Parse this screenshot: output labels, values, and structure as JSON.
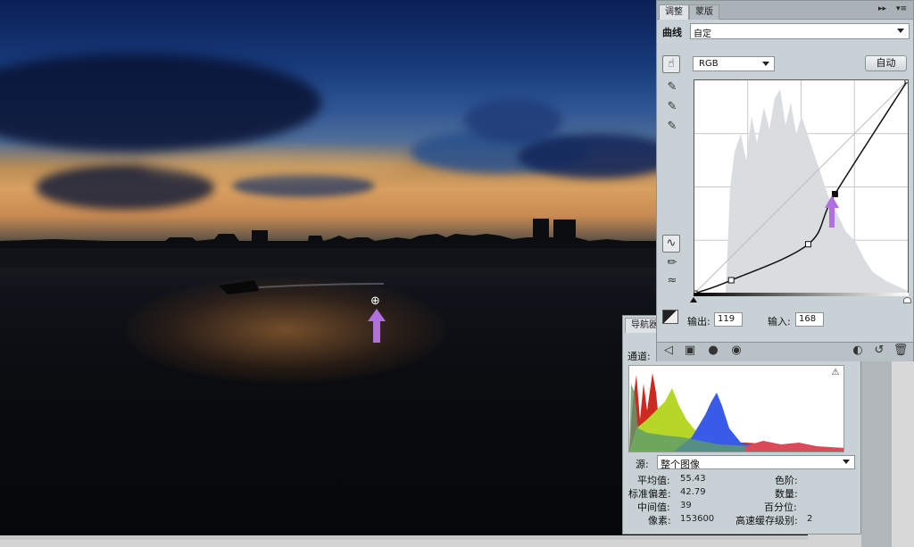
{
  "adjustments": {
    "tabs": [
      "调整",
      "蒙版"
    ],
    "preset_label": "曲线",
    "preset_value": "自定",
    "channel_value": "RGB",
    "auto_label": "自动",
    "output_label": "输出:",
    "output_value": "119",
    "input_label": "输入:",
    "input_value": "168",
    "curve": {
      "input_range": [
        0,
        255
      ],
      "output_range": [
        0,
        255
      ],
      "points": [
        [
          0,
          0
        ],
        [
          44,
          16
        ],
        [
          136,
          59
        ],
        [
          168,
          119
        ],
        [
          255,
          255
        ]
      ]
    }
  },
  "histogram": {
    "tab_label": "导航器",
    "channel_label": "通道:",
    "source_label": "源:",
    "source_value": "整个图像",
    "stats": {
      "mean_label": "平均值:",
      "mean_value": "55.43",
      "std_label": "标准偏差:",
      "std_value": "42.79",
      "median_label": "中间值:",
      "median_value": "39",
      "pixels_label": "像素:",
      "pixels_value": "153600",
      "level_label": "色阶:",
      "count_label": "数量:",
      "percentile_label": "百分位:",
      "cache_label": "高速缓存级别:",
      "cache_value": "2"
    }
  },
  "colors": {
    "accent_arrow": "#b070e0",
    "panel_bg": "#c8d2d6"
  }
}
